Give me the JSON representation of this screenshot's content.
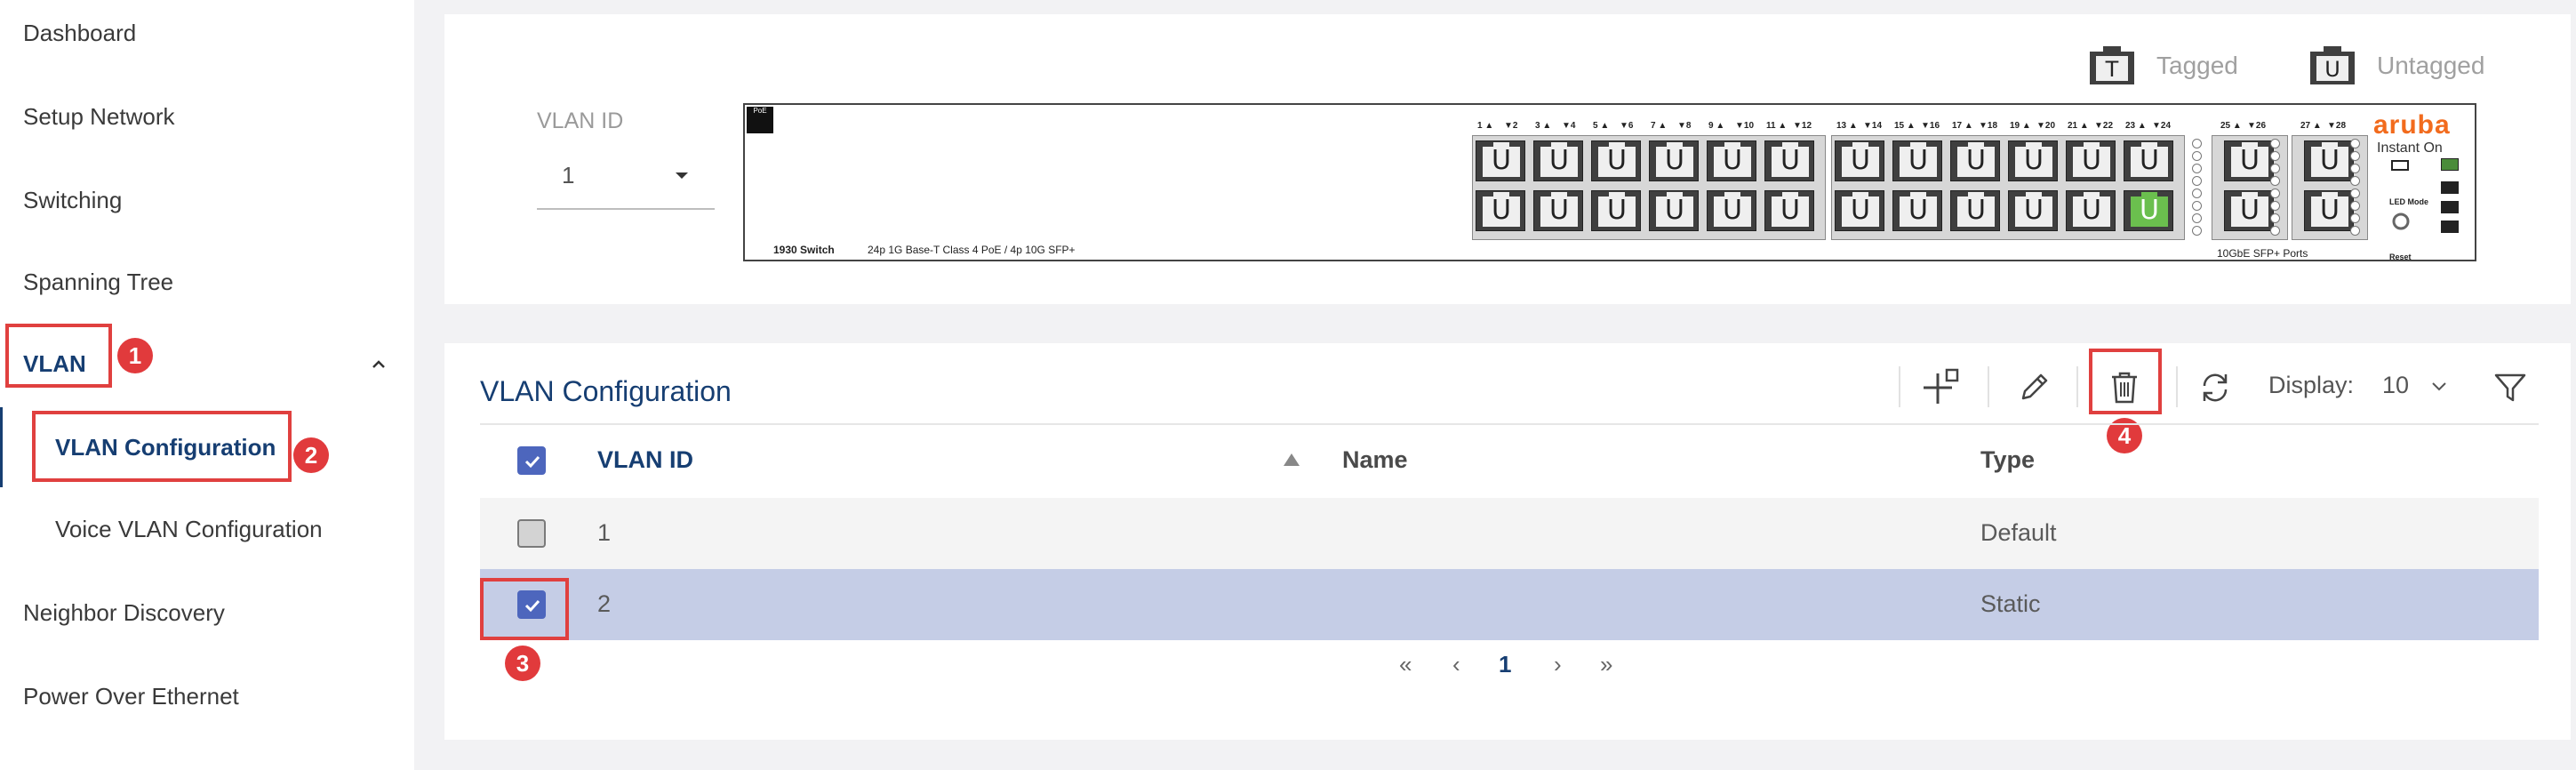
{
  "sidebar": {
    "items": [
      {
        "label": "Dashboard"
      },
      {
        "label": "Setup Network"
      },
      {
        "label": "Switching"
      },
      {
        "label": "Spanning Tree"
      },
      {
        "label": "VLAN"
      },
      {
        "label": "VLAN Configuration"
      },
      {
        "label": "Voice VLAN Configuration"
      },
      {
        "label": "Neighbor Discovery"
      },
      {
        "label": "Power Over Ethernet"
      }
    ]
  },
  "annotations": {
    "badge1": "1",
    "badge2": "2",
    "badge3": "3",
    "badge4": "4"
  },
  "top_panel": {
    "legend_tagged": "Tagged",
    "legend_untagged": "Untagged",
    "legend_tagged_letter": "T",
    "legend_untagged_letter": "U",
    "vlan_id_label": "VLAN ID",
    "vlan_id_value": "1"
  },
  "switch": {
    "model": "1930 Switch",
    "description": "24p 1G Base-T Class 4 PoE / 4p 10G SFP+",
    "poe_tag": "PoE",
    "sfp_label": "10GbE SFP+ Ports",
    "brand": "aruba",
    "brand_sub": "Instant On",
    "led_mode_label": "LED Mode",
    "reset_label": "Reset",
    "port_labels_group1": [
      "1 ▲",
      "▼2",
      "3 ▲",
      "▼4",
      "5 ▲",
      "▼6",
      "7 ▲",
      "▼8",
      "9 ▲",
      "▼10",
      "11 ▲",
      "▼12"
    ],
    "port_labels_group2": [
      "13 ▲",
      "▼14",
      "15 ▲",
      "▼16",
      "17 ▲",
      "▼18",
      "19 ▲",
      "▼20",
      "21 ▲",
      "▼22",
      "23 ▲",
      "▼24"
    ],
    "sfp_labels_a": [
      "25 ▲",
      "▼26"
    ],
    "sfp_labels_b": [
      "27 ▲",
      "▼28"
    ],
    "port_letter": "U",
    "green_port": "24"
  },
  "vlan_config": {
    "title": "VLAN Configuration",
    "display_label": "Display:",
    "display_value": "10",
    "columns": {
      "vlan_id": "VLAN ID",
      "name": "Name",
      "type": "Type"
    },
    "rows": [
      {
        "vlan_id": "1",
        "name": "",
        "type": "Default",
        "checked": false
      },
      {
        "vlan_id": "2",
        "name": "",
        "type": "Static",
        "checked": true
      }
    ],
    "pagination": {
      "first": "«",
      "prev": "‹",
      "current": "1",
      "next": "›",
      "last": "»"
    }
  },
  "colors": {
    "accent": "#163e72",
    "checkbox": "#4d66bd",
    "selected_row": "#c5cde6",
    "annotation": "#e13a3c",
    "brand": "#f26b1d",
    "untagged_green": "#6bbf4e"
  }
}
